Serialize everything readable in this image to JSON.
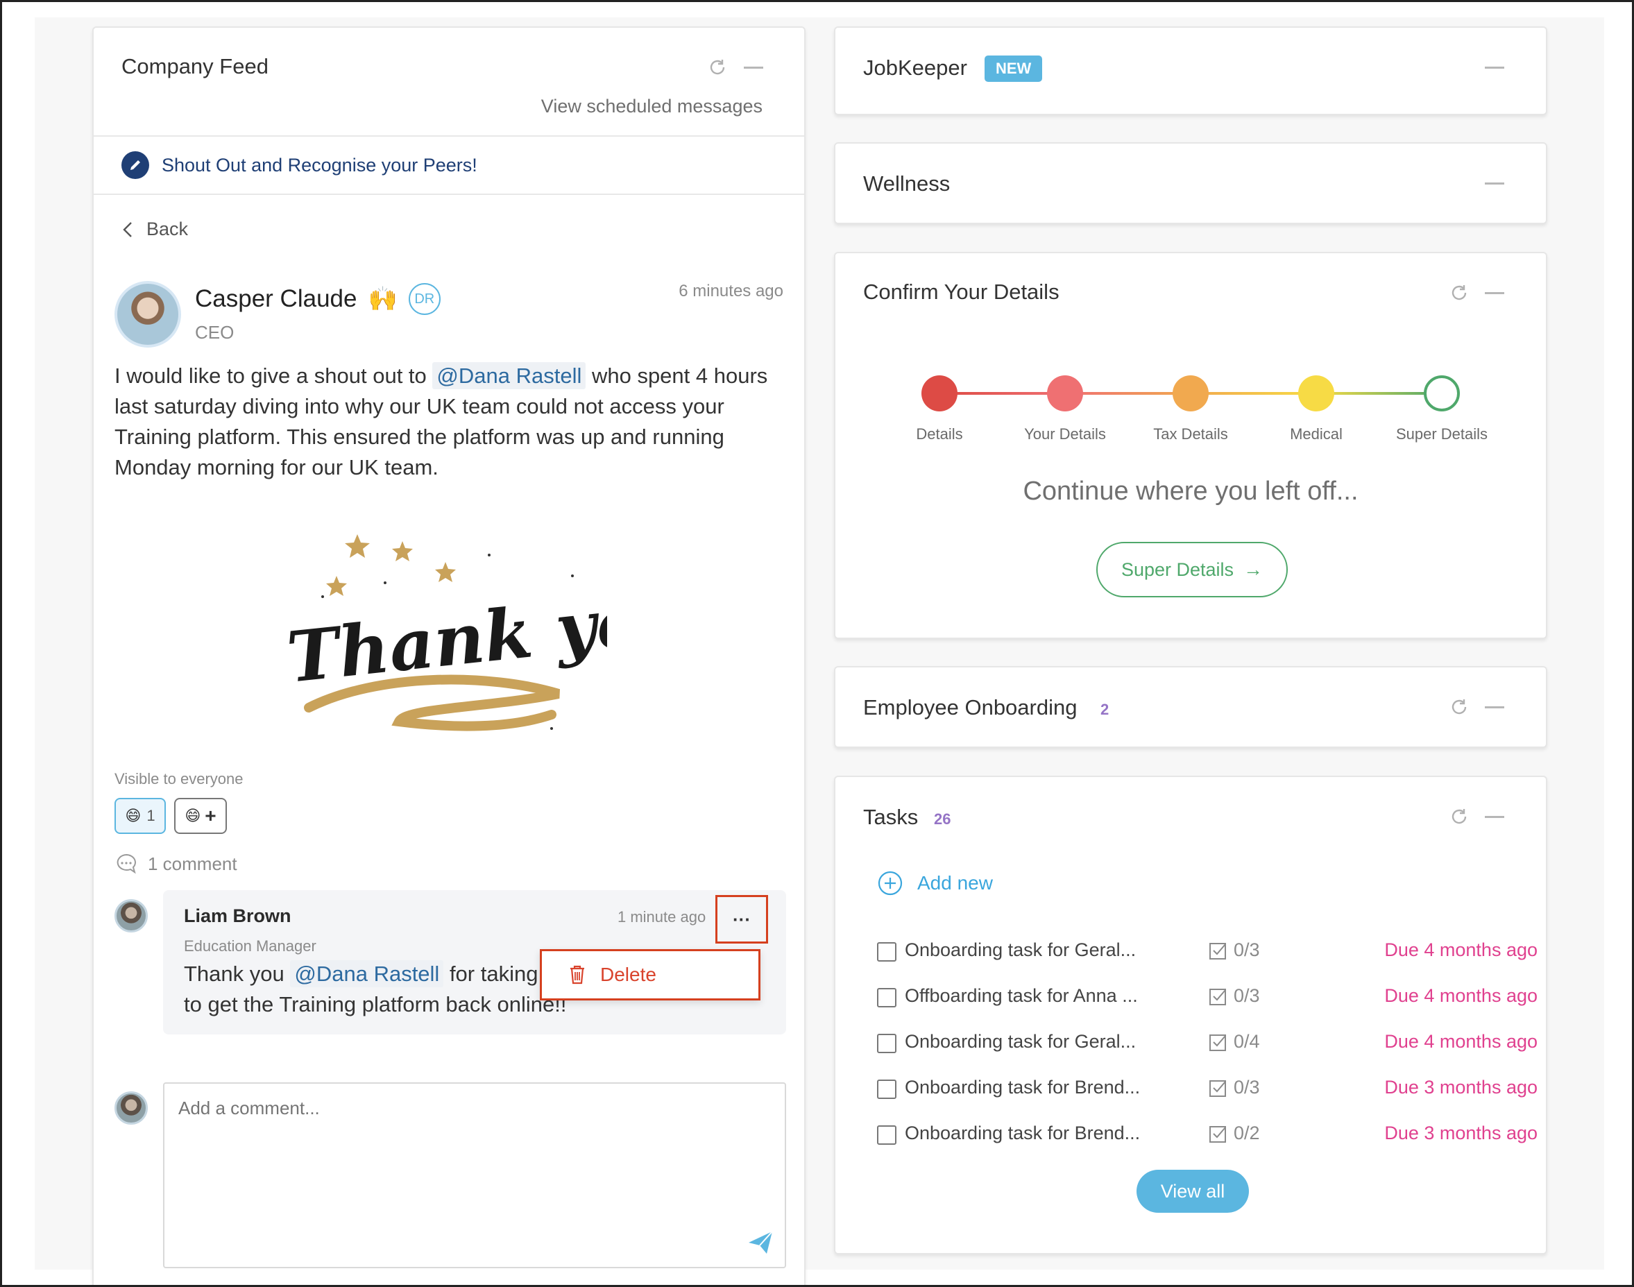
{
  "colors": {
    "accent_blue": "#5bb6e0",
    "link_blue": "#2d6aa0",
    "due_pink": "#e0418f",
    "count_purple": "#9574c6",
    "delete_red": "#d9432c",
    "success_green": "#4fa86b"
  },
  "feed": {
    "title": "Company Feed",
    "scheduled_link": "View scheduled messages",
    "shoutout_prompt": "Shout Out and Recognise your Peers!",
    "back_label": "Back",
    "icons": [
      "refresh-icon",
      "minimize-icon",
      "pencil-icon",
      "chevron-left-icon"
    ]
  },
  "post": {
    "author": "Casper Claude",
    "author_emoji": "🙌",
    "role": "CEO",
    "dr_badge": "DR",
    "time": "6 minutes ago",
    "text_before": "I would like to give a shout out to ",
    "mention": "@Dana Rastell",
    "text_after": " who spent 4 hours last saturday diving into why our UK team could not access your Training platform. This ensured the platform was up and running Monday morning for our UK team.",
    "image_text": "Thank you!",
    "visibility": "Visible to everyone",
    "reaction_emoji": "😄",
    "reaction_count": "1",
    "add_reaction_symbol": "+",
    "comment_count": "1 comment"
  },
  "comment": {
    "author": "Liam Brown",
    "role": "Education Manager",
    "time": "1 minute ago",
    "menu_label": "···",
    "text_before": "Thank you ",
    "mention": "@Dana Rastell",
    "text_after": " for taking ti",
    "text_line2": "to get the Training platform back online!!",
    "delete_label": "Delete"
  },
  "comment_input": {
    "placeholder": "Add a comment..."
  },
  "jobkeeper": {
    "title": "JobKeeper",
    "badge": "NEW"
  },
  "wellness": {
    "title": "Wellness"
  },
  "confirm_details": {
    "title": "Confirm Your Details",
    "steps": [
      {
        "label": "Details",
        "color": "#dd4b45",
        "status": "complete"
      },
      {
        "label": "Your Details",
        "color": "#ef7072",
        "status": "complete"
      },
      {
        "label": "Tax Details",
        "color": "#f1a94f",
        "status": "complete"
      },
      {
        "label": "Medical",
        "color": "#f7db45",
        "status": "complete"
      },
      {
        "label": "Super Details",
        "color": "#4fa86b",
        "status": "current"
      }
    ],
    "continue_text": "Continue where you left off...",
    "cta_label": "Super Details",
    "cta_arrow": "→"
  },
  "onboarding": {
    "title": "Employee Onboarding",
    "count": "2"
  },
  "tasks": {
    "title": "Tasks",
    "count": "26",
    "add_new": "Add new",
    "items": [
      {
        "name": "Onboarding task for Geral...",
        "progress": "0/3",
        "due": "Due 4 months ago"
      },
      {
        "name": "Offboarding task for Anna ...",
        "progress": "0/3",
        "due": "Due 4 months ago"
      },
      {
        "name": "Onboarding task for Geral...",
        "progress": "0/4",
        "due": "Due 4 months ago"
      },
      {
        "name": "Onboarding task for Brend...",
        "progress": "0/3",
        "due": "Due 3 months ago"
      },
      {
        "name": "Onboarding task for Brend...",
        "progress": "0/2",
        "due": "Due 3 months ago"
      }
    ],
    "view_all": "View all"
  }
}
